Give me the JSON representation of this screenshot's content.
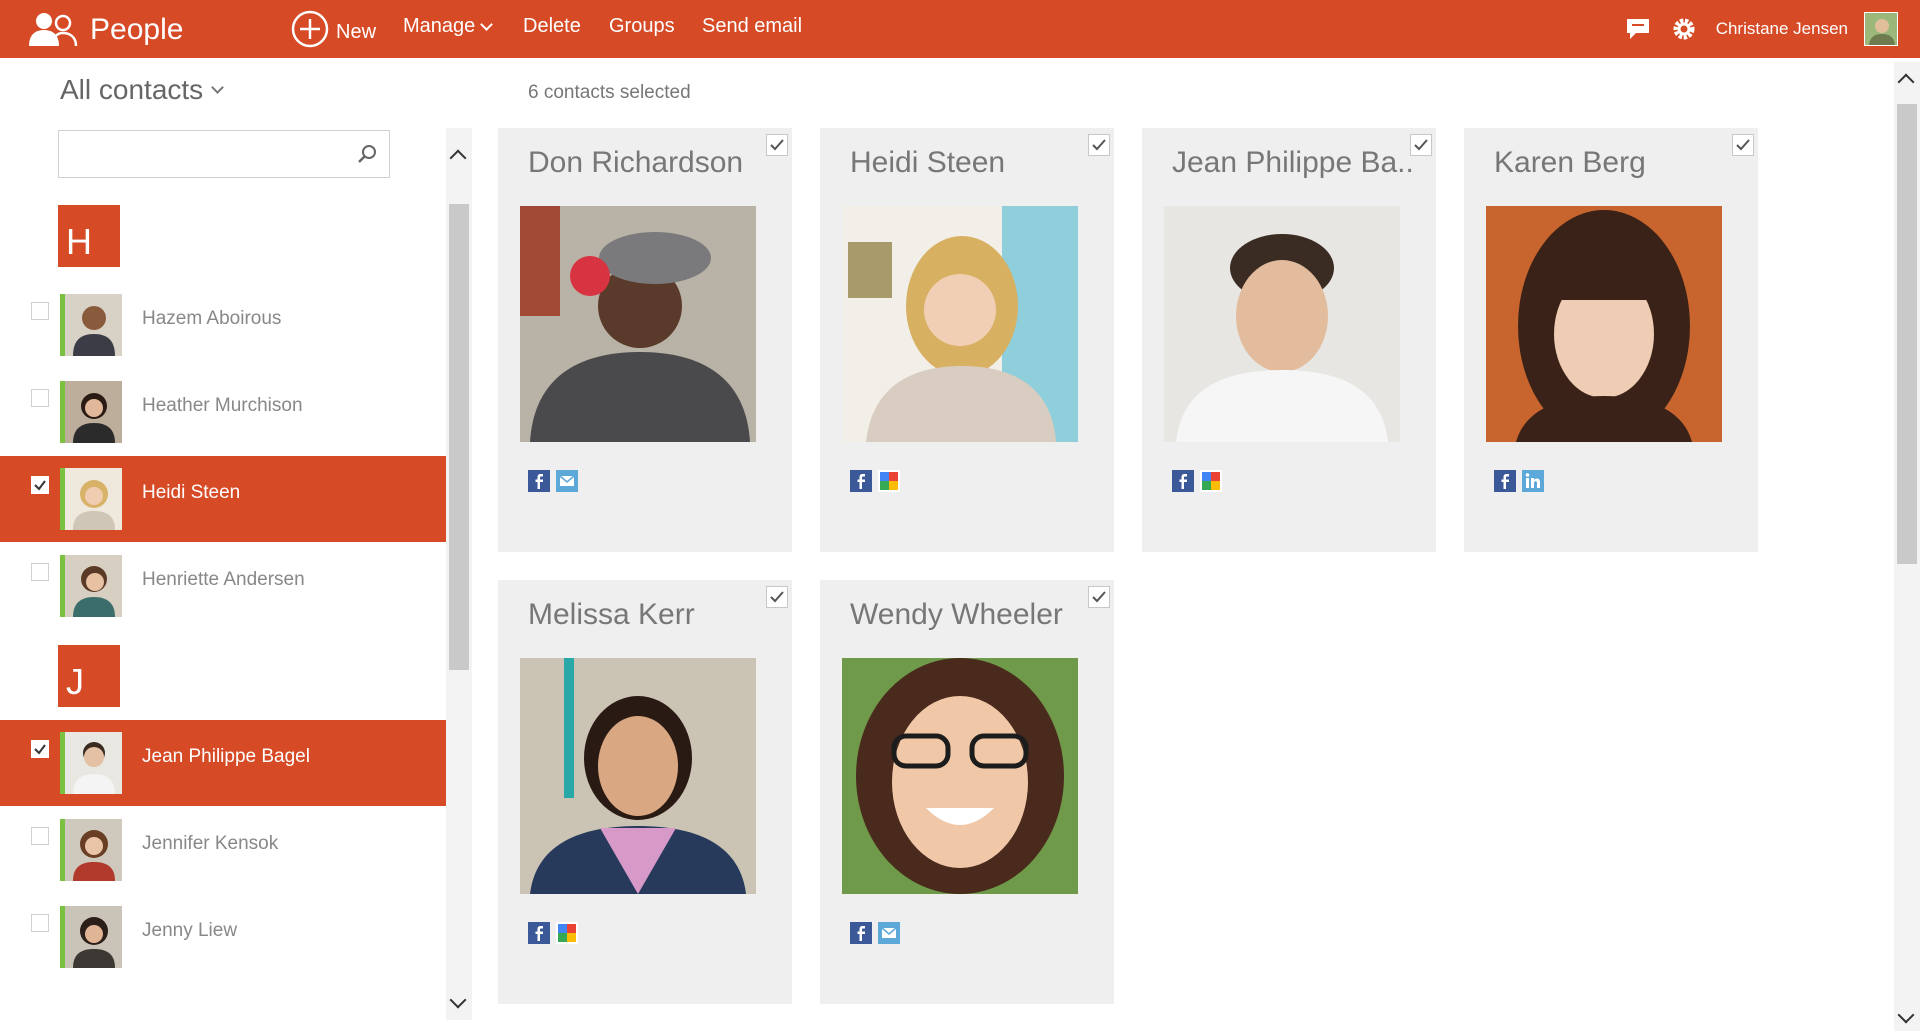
{
  "app": {
    "title": "People"
  },
  "commands": {
    "new": "New",
    "manage": "Manage",
    "delete": "Delete",
    "groups": "Groups",
    "send_email": "Send email"
  },
  "user": {
    "name": "Christane Jensen"
  },
  "sidebar": {
    "filter_label": "All contacts",
    "search": {
      "value": "",
      "placeholder": ""
    },
    "groups": [
      {
        "letter": "H",
        "contacts": [
          {
            "name": "Hazem Aboirous",
            "selected": false
          },
          {
            "name": "Heather Murchison",
            "selected": false
          },
          {
            "name": "Heidi Steen",
            "selected": true
          },
          {
            "name": "Henriette Andersen",
            "selected": false
          }
        ]
      },
      {
        "letter": "J",
        "contacts": [
          {
            "name": "Jean Philippe Bagel",
            "selected": true
          },
          {
            "name": "Jennifer Kensok",
            "selected": false
          },
          {
            "name": "Jenny Liew",
            "selected": false
          }
        ]
      }
    ]
  },
  "main": {
    "selection_status": "6 contacts selected",
    "cards": [
      {
        "name": "Don Richardson",
        "social": [
          "facebook-icon",
          "messenger-icon"
        ]
      },
      {
        "name": "Heidi Steen",
        "social": [
          "facebook-icon",
          "google-icon"
        ]
      },
      {
        "name": "Jean Philippe Ba...",
        "social": [
          "facebook-icon",
          "google-icon"
        ]
      },
      {
        "name": "Karen Berg",
        "social": [
          "facebook-icon",
          "linkedin-icon"
        ]
      },
      {
        "name": "Melissa Kerr",
        "social": [
          "facebook-icon",
          "google-icon"
        ]
      },
      {
        "name": "Wendy Wheeler",
        "social": [
          "facebook-icon",
          "messenger-icon"
        ]
      }
    ]
  },
  "colors": {
    "accent": "#d64a26",
    "presence": "#7ac142",
    "card_bg": "#efefef"
  }
}
